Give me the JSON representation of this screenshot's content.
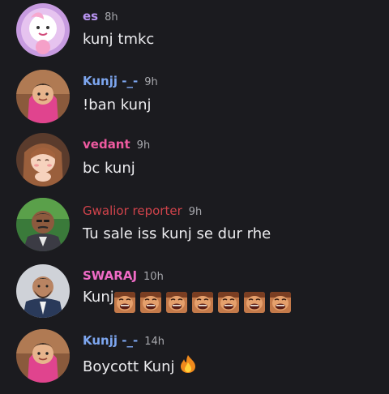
{
  "messages": [
    {
      "username": "es",
      "username_color": "#b994f2",
      "timestamp": "8h",
      "content": "kunj tmkc"
    },
    {
      "username": "Kunjj -_-",
      "username_color": "#7da6ef",
      "timestamp": "9h",
      "content": "!ban kunj"
    },
    {
      "username": "vedant",
      "username_color": "#ee5aa0",
      "timestamp": "9h",
      "content": "bc kunj"
    },
    {
      "username": "Gwalior reporter",
      "username_color": "#d0434b",
      "timestamp": "9h",
      "content": "Tu sale iss kunj se dur rhe"
    },
    {
      "username": "SWARAJ",
      "username_color": "#f06bc6",
      "timestamp": "10h",
      "content": "Kunj",
      "emoji_name": "laughing-face-emoji",
      "emoji_count": 7
    },
    {
      "username": "Kunjj -_-",
      "username_color": "#7da6ef",
      "timestamp": "14h",
      "content": "Boycott Kunj",
      "trailing_emoji": "fire-emoji"
    }
  ]
}
